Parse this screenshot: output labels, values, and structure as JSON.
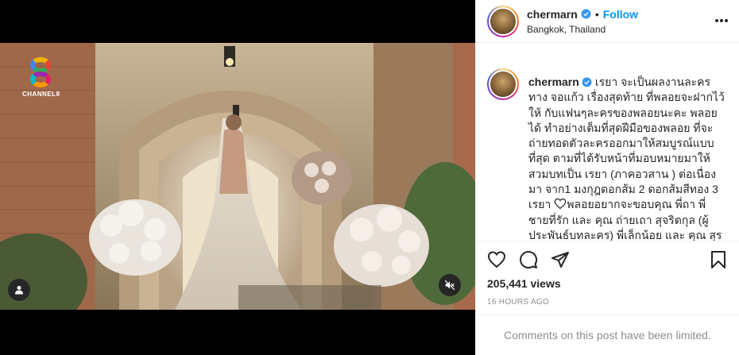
{
  "post": {
    "username": "chermarn",
    "follow_label": "Follow",
    "dot_separator": "•",
    "location": "Bangkok, Thailand",
    "channel_logo_text": "CHANNEL8",
    "caption_html_parts": [
      "เรยา จะเป็นผลงานละครทาง จอแก้ว เรื่องสุดท้าย ที่พลอยจะฝากไว้ให้ กับแฟนๆละครของพลอยนะคะ พลอยได้ ทำอย่างเต็มที่สุดฝีมือของพลอย ที่จะ ถ่ายทอดตัวละครออกมาให้สมบูรณ์แบบ ที่สุด ตามที่ได้รับหน้าที่มอบหมายมาให้ สวมบทเป็น เรยา (ภาคอวสาน ) ต่อเนื่องมา จาก1 มงกุฎดอกส้ม 2 ดอกส้มสีทอง 3 เรยา ",
      "พลอยอยากจะขอบคุณ พี่ถา พี่ ชายที่รัก และ คุณ ถ่ายเถา สุจริตกุล (ผู้ ประพันธ์บทละคร) พี่เล็กน้อย และ คุณ สุร ชัย เผ่าศรีวิชัยศักดิ์ ที่ไว้วางใจให้พลอยได้"
    ],
    "likes": "205,441 views",
    "timestamp": "16 HOURS AGO",
    "comments_notice": "Comments on this post have been limited."
  },
  "colors": {
    "accent": "#0095f6",
    "muted_text": "#8e8e8e",
    "border": "#efefef",
    "verified_badge": "#3897f0"
  },
  "icons": [
    "verified-icon",
    "more-options-icon",
    "heart-icon",
    "comment-icon",
    "share-icon",
    "bookmark-icon",
    "user-tag-icon",
    "mute-icon",
    "white-heart-icon"
  ]
}
